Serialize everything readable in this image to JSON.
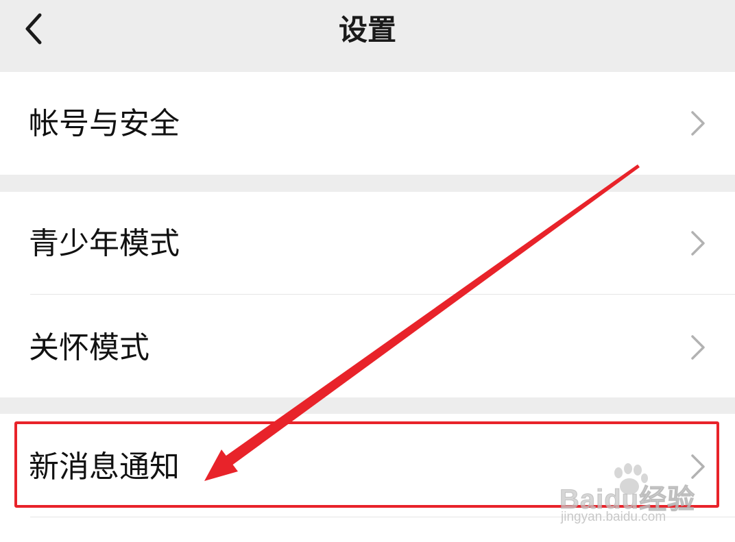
{
  "header": {
    "title": "设置"
  },
  "settings": {
    "account_security": "帐号与安全",
    "youth_mode": "青少年模式",
    "care_mode": "关怀模式",
    "new_message_notification": "新消息通知"
  },
  "watermark": {
    "brand": "Baidu经验",
    "url": "jingyan.baidu.com"
  },
  "colors": {
    "background": "#ededed",
    "row_background": "#ffffff",
    "annotation": "#e8232a",
    "chevron": "#b2b2b2"
  },
  "icons": {
    "back": "back-arrow-icon",
    "chevron": "chevron-right-icon",
    "watermark_logo": "paw-logo-icon"
  }
}
